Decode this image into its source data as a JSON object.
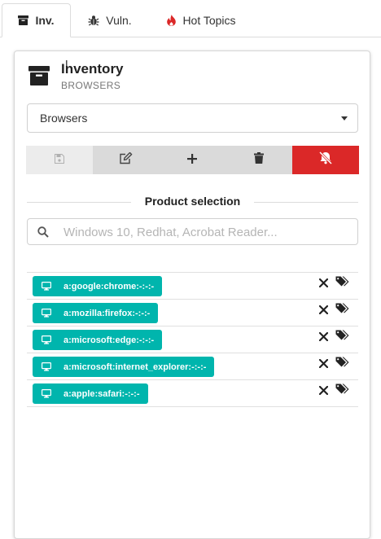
{
  "tabs": [
    {
      "label": "Inv.",
      "icon": "archive-icon",
      "active": true
    },
    {
      "label": "Vuln.",
      "icon": "bug-icon",
      "active": false
    },
    {
      "label": "Hot Topics",
      "icon": "fire-icon",
      "active": false,
      "icon_color": "#db2828"
    }
  ],
  "header": {
    "title": "Inventory",
    "subtitle": "BROWSERS",
    "icon": "archive-icon"
  },
  "inventory_select": {
    "value": "Browsers"
  },
  "toolbar": {
    "buttons": [
      "save-icon",
      "edit-icon",
      "plus-icon",
      "trash-icon",
      "bell-slash-icon"
    ],
    "alert_color": "#db2828"
  },
  "product_selection": {
    "label": "Product selection"
  },
  "search": {
    "placeholder": "Windows 10, Redhat, Acrobat Reader..."
  },
  "products": [
    {
      "cpe": "a:google:chrome:-:-:-"
    },
    {
      "cpe": "a:mozilla:firefox:-:-:-"
    },
    {
      "cpe": "a:microsoft:edge:-:-:-"
    },
    {
      "cpe": "a:microsoft:internet_explorer:-:-:-"
    },
    {
      "cpe": "a:apple:safari:-:-:-"
    }
  ],
  "colors": {
    "chip": "#00b5ad",
    "accent_red": "#db2828"
  }
}
